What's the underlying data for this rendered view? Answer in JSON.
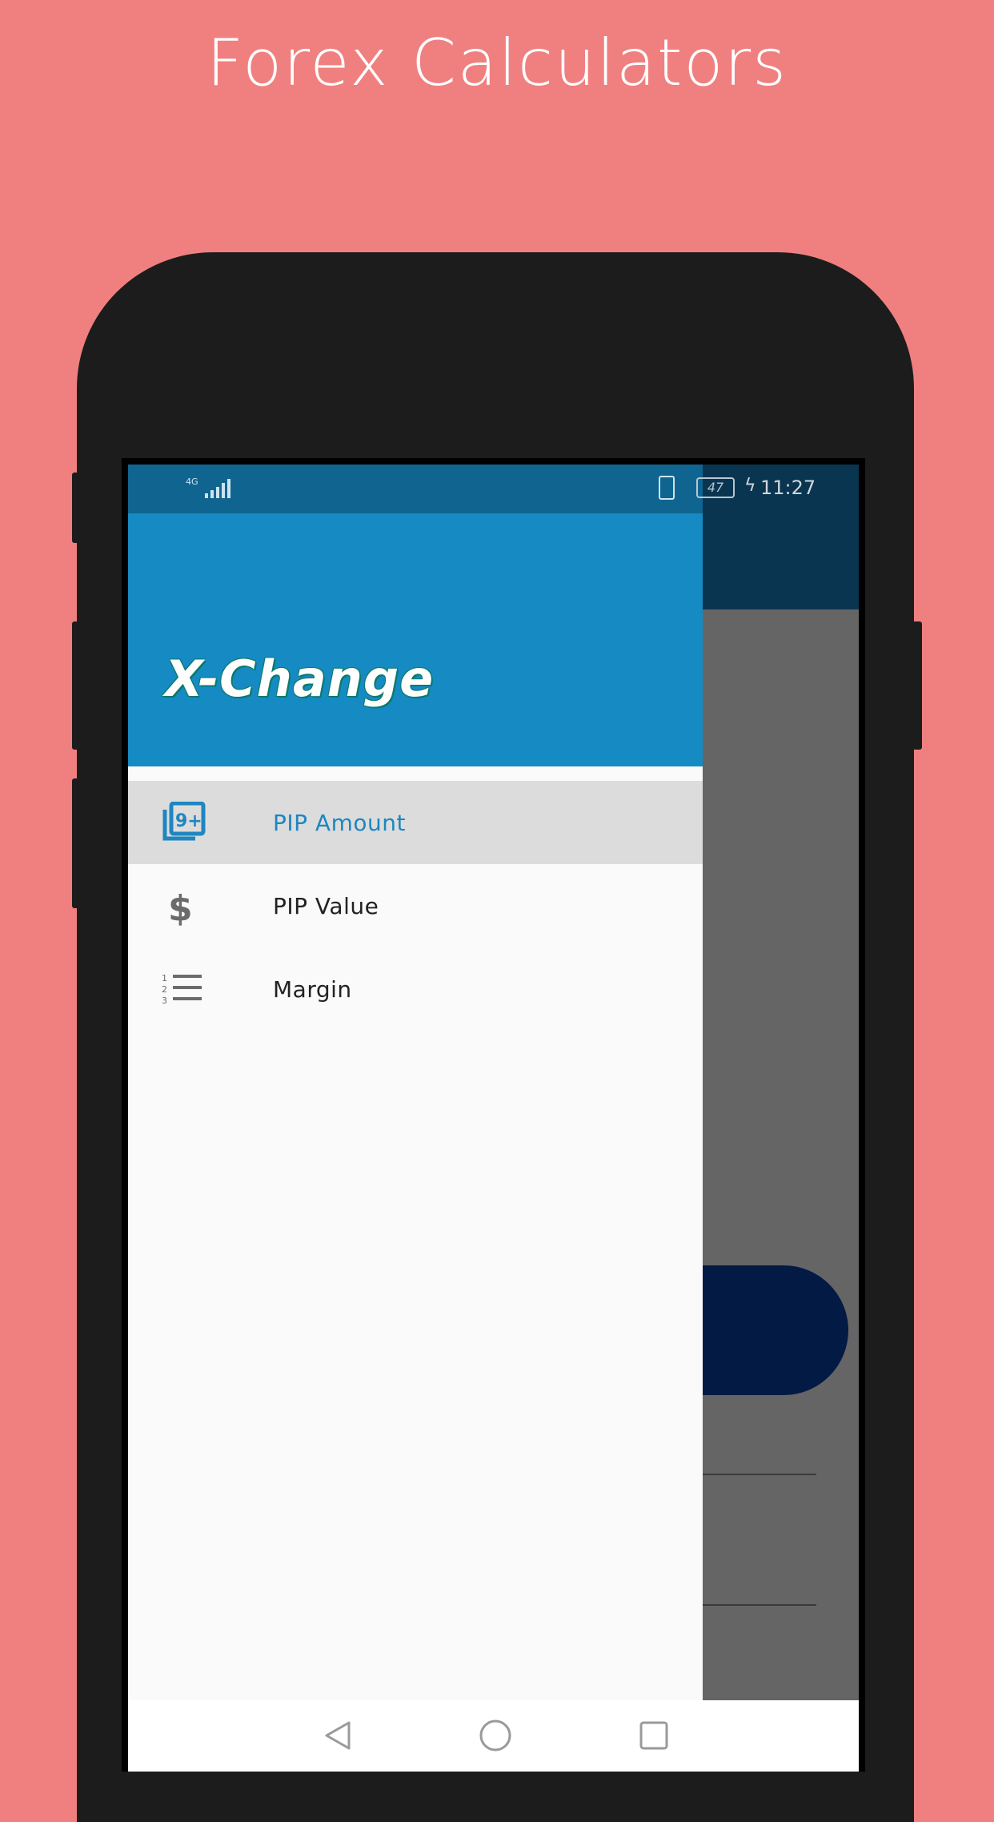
{
  "promo": {
    "headline": "Forex Calculators"
  },
  "status_bar": {
    "network": "4G",
    "battery": "47",
    "time": "11:27"
  },
  "drawer": {
    "brand": "X-Change",
    "items": [
      {
        "label": "PIP Amount",
        "icon": "pip-amount-icon",
        "selected": true
      },
      {
        "label": "PIP Value",
        "icon": "dollar-icon",
        "selected": false
      },
      {
        "label": "Margin",
        "icon": "numbered-list-icon",
        "selected": false
      }
    ]
  },
  "colors": {
    "background": "#f08080",
    "drawer_header": "#168ac3",
    "status_bar": "#106590",
    "selected_text": "#1e86c0",
    "selected_row": "#dcdcdc"
  }
}
